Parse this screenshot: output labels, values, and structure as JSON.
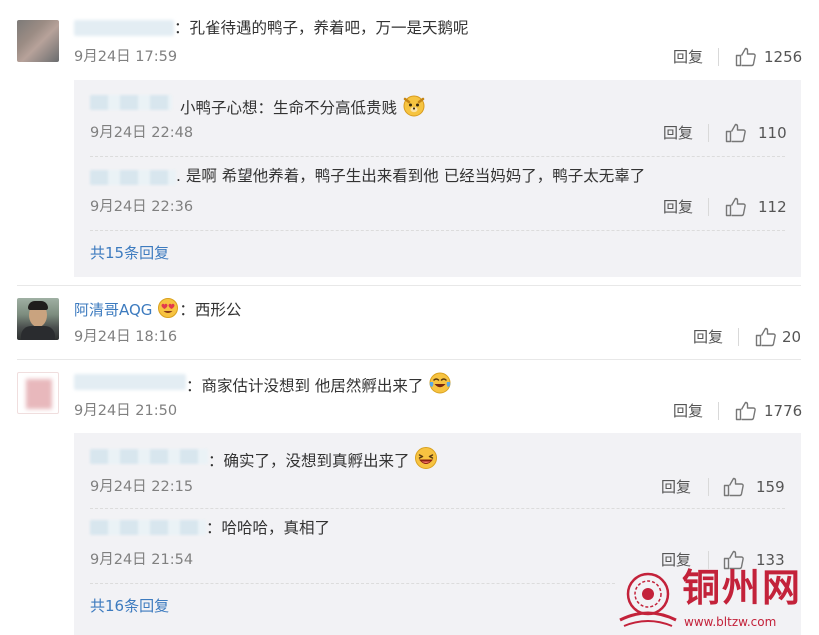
{
  "comments": [
    {
      "text": "：孔雀待遇的鸭子，养着吧，万一是天鹅呢",
      "time": "9月24日 17:59",
      "reply_label": "回复",
      "likes": "1256",
      "replies": [
        {
          "text": "小鸭子心想：生命不分高低贵贱",
          "time": "9月24日 22:48",
          "reply_label": "回复",
          "likes": "110"
        },
        {
          "text": ". 是啊 希望他养着，鸭子生出来看到他 已经当妈妈了，鸭子太无辜了",
          "time": "9月24日 22:36",
          "reply_label": "回复",
          "likes": "112"
        }
      ],
      "more_replies": "共15条回复"
    },
    {
      "username": "阿清哥AQG",
      "text": "：西形公",
      "time": "9月24日 18:16",
      "reply_label": "回复",
      "likes": "20"
    },
    {
      "text": "：商家估计没想到 他居然孵出来了",
      "time": "9月24日 21:50",
      "reply_label": "回复",
      "likes": "1776",
      "replies": [
        {
          "text": "：确实了，没想到真孵出来了",
          "time": "9月24日 22:15",
          "reply_label": "回复",
          "likes": "159"
        },
        {
          "text": "：哈哈哈，真相了",
          "time": "9月24日 21:54",
          "reply_label": "回复",
          "likes": "133"
        }
      ],
      "more_replies": "共16条回复"
    }
  ],
  "watermark": {
    "title": "铜州网",
    "url": "www.bltzw.com"
  },
  "colors": {
    "link": "#3d7bbf",
    "reply_box": "#f2f2f5",
    "watermark": "#c3223a"
  },
  "icons": {
    "like": "thumbs-up-icon",
    "emoji_dog": "dog-face-emoji",
    "emoji_heart_eyes": "heart-eyes-emoji",
    "emoji_laugh_cry": "tears-of-joy-emoji",
    "emoji_laugh": "laughing-emoji"
  }
}
